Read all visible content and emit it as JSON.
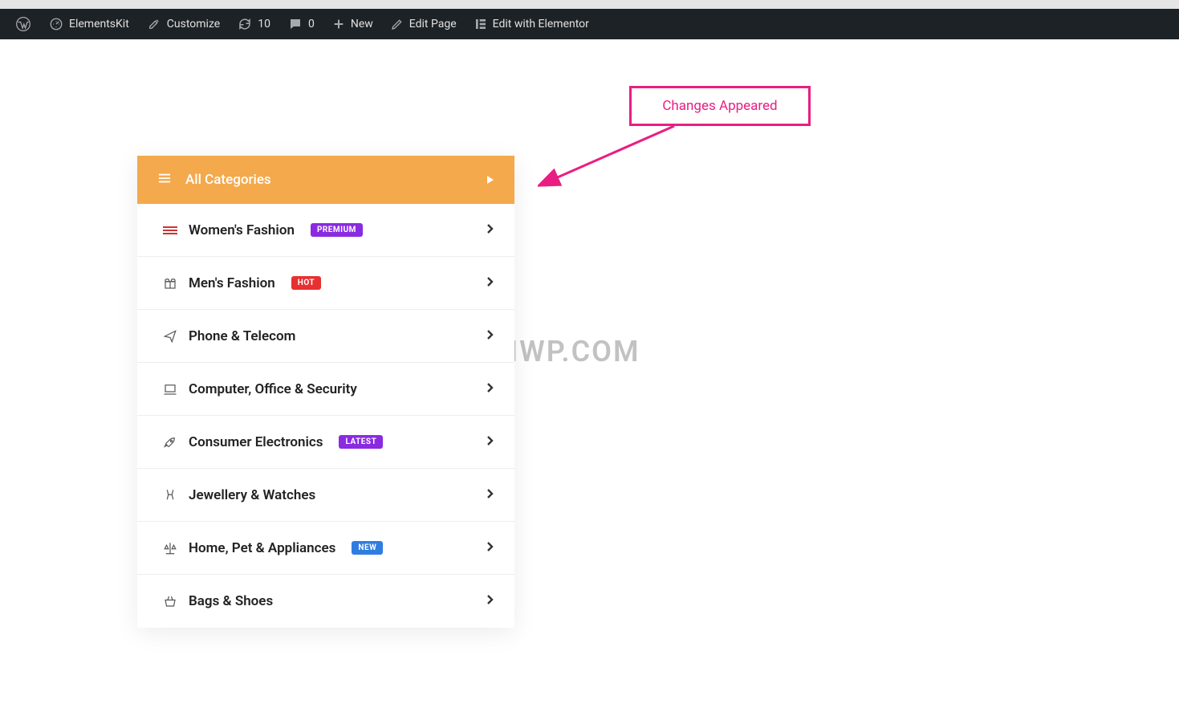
{
  "admin_bar": {
    "items": [
      {
        "icon": "wordpress",
        "label": ""
      },
      {
        "icon": "gauge",
        "label": "ElementsKit"
      },
      {
        "icon": "brush",
        "label": "Customize"
      },
      {
        "icon": "refresh",
        "label": "10"
      },
      {
        "icon": "comment",
        "label": "0"
      },
      {
        "icon": "plus",
        "label": "New"
      },
      {
        "icon": "pencil",
        "label": "Edit Page"
      },
      {
        "icon": "elementor",
        "label": "Edit with Elementor"
      }
    ]
  },
  "callout_text": "Changes Appeared",
  "watermark": "HEIWP.COM",
  "cat_panel": {
    "header": "All Categories",
    "items": [
      {
        "icon": "lines",
        "label": "Women's Fashion",
        "badge": "PREMIUM",
        "badge_style": "purple",
        "chevron": true
      },
      {
        "icon": "gift",
        "label": "Men's Fashion",
        "badge": "HOT",
        "badge_style": "red",
        "chevron": true
      },
      {
        "icon": "send",
        "label": "Phone & Telecom",
        "badge": null,
        "badge_style": null,
        "chevron": true
      },
      {
        "icon": "laptop",
        "label": "Computer, Office & Security",
        "badge": null,
        "badge_style": null,
        "chevron": true
      },
      {
        "icon": "rocket",
        "label": "Consumer Electronics",
        "badge": "LATEST",
        "badge_style": "purple",
        "chevron": true
      },
      {
        "icon": "cheers",
        "label": "Jewellery & Watches",
        "badge": null,
        "badge_style": null,
        "chevron": true
      },
      {
        "icon": "scale",
        "label": "Home, Pet & Appliances",
        "badge": "NEW",
        "badge_style": "blue",
        "chevron": true
      },
      {
        "icon": "basket",
        "label": "Bags & Shoes",
        "badge": null,
        "badge_style": null,
        "chevron": true
      }
    ]
  }
}
